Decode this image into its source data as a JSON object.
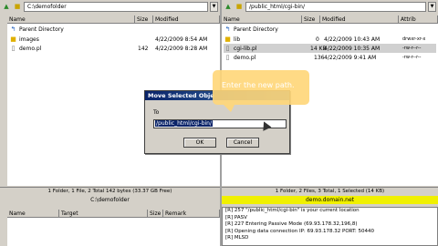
{
  "left": {
    "path": "C:\\demofolder",
    "columns": {
      "name": "Name",
      "size": "Size",
      "modified": "Modified"
    },
    "files": [
      {
        "icon": "parent-dir-icon",
        "name": "Parent Directory",
        "size": "",
        "modified": ""
      },
      {
        "icon": "folder-icon",
        "name": "images",
        "size": "",
        "modified": "4/22/2009 8:54 AM"
      },
      {
        "icon": "file-icon",
        "name": "demo.pl",
        "size": "142",
        "modified": "4/22/2009 8:28 AM"
      }
    ],
    "status": "1 Folder, 1 File, 2 Total 142 bytes (33.37 GB Free)",
    "host": "C:\\demofolder"
  },
  "right": {
    "path": "/public_html/cgi-bin/",
    "columns": {
      "name": "Name",
      "size": "Size",
      "modified": "Modified",
      "attrib": "Attrib"
    },
    "files": [
      {
        "icon": "parent-dir-icon",
        "name": "Parent Directory",
        "size": "",
        "modified": "",
        "attrib": ""
      },
      {
        "icon": "folder-icon",
        "name": "lib",
        "size": "0",
        "modified": "4/22/2009 10:43 AM",
        "attrib": "drwxr-xr-x"
      },
      {
        "icon": "file-icon",
        "name": "cgi-lib.pl",
        "size": "14 KB",
        "modified": "4/22/2009 10:35 AM",
        "attrib": "-rw-r--r--"
      },
      {
        "icon": "file-icon",
        "name": "demo.pl",
        "size": "136",
        "modified": "4/22/2009 9:41 AM",
        "attrib": "-rw-r--r--"
      }
    ],
    "status": "1 Folder, 2 Files, 3 Total, 1 Selected (14 KB)",
    "host": "demo.domain.net"
  },
  "queue": {
    "columns": {
      "name": "Name",
      "target": "Target",
      "size": "Size",
      "remark": "Remark"
    }
  },
  "log": [
    "[R] 257 \"/public_html/cgi-bin\" is your current location",
    "[R] PASV",
    "[R] 227 Entering Passive Mode (69.93.178.32,196,8)",
    "[R] Opening data connection IP: 69.93.178.32 PORT: 50440",
    "[R] MLSD"
  ],
  "dialog": {
    "title": "Move Selected Obje",
    "label": "To",
    "value": "/public_html/cgi-bin/",
    "ok": "OK",
    "cancel": "Cancel"
  },
  "tooltip": {
    "text": "Enter the new path."
  },
  "colors": {
    "host_yellow": "#f0f000",
    "selected_row": "#d0d0d0",
    "dialog_title": "#0a246a"
  }
}
